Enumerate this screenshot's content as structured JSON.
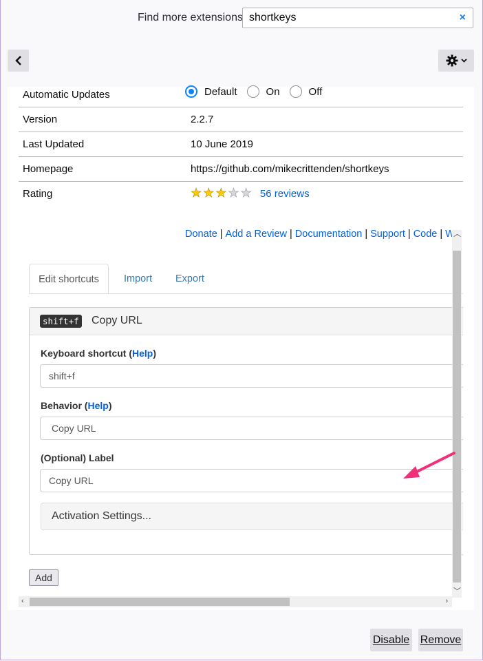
{
  "header": {
    "find_label": "Find more extensions",
    "search_value": "shortkeys",
    "clear_glyph": "×"
  },
  "nav": {
    "back_icon": "chevron-left-icon",
    "settings_icon": "gear-icon"
  },
  "details": {
    "rows": [
      {
        "key": "Automatic Updates"
      },
      {
        "key": "Version",
        "value": "2.2.7"
      },
      {
        "key": "Last Updated",
        "value": "10 June 2019"
      },
      {
        "key": "Homepage",
        "value": "https://github.com/mikecrittenden/shortkeys"
      },
      {
        "key": "Rating",
        "value": "56 reviews"
      }
    ],
    "updates_options": [
      "Default",
      "On",
      "Off"
    ],
    "updates_selected": "Default",
    "rating_stars": 3,
    "rating_max": 5
  },
  "options_page": {
    "links": [
      "Donate",
      "Add a Review",
      "Documentation",
      "Support",
      "Code",
      "W"
    ],
    "tabs": [
      "Edit shortcuts",
      "Import",
      "Export"
    ],
    "active_tab": "Edit shortcuts",
    "shortcut": {
      "key_badge": "shift+f",
      "title": "Copy URL",
      "kb_label": "Keyboard shortcut (",
      "help": "Help",
      "close_paren": ")",
      "kb_value": "shift+f",
      "behavior_label": "Behavior (",
      "behavior_value": "Copy URL",
      "optional_label": "(Optional) Label",
      "label_value": "Copy URL",
      "activation": "Activation Settings..."
    },
    "add_label": "Add"
  },
  "footer": {
    "disable_label": "Disable",
    "remove_label": "Remove"
  },
  "colors": {
    "accent": "#0a84ff",
    "link": "#0060df",
    "annotation_arrow": "#f0317a"
  }
}
